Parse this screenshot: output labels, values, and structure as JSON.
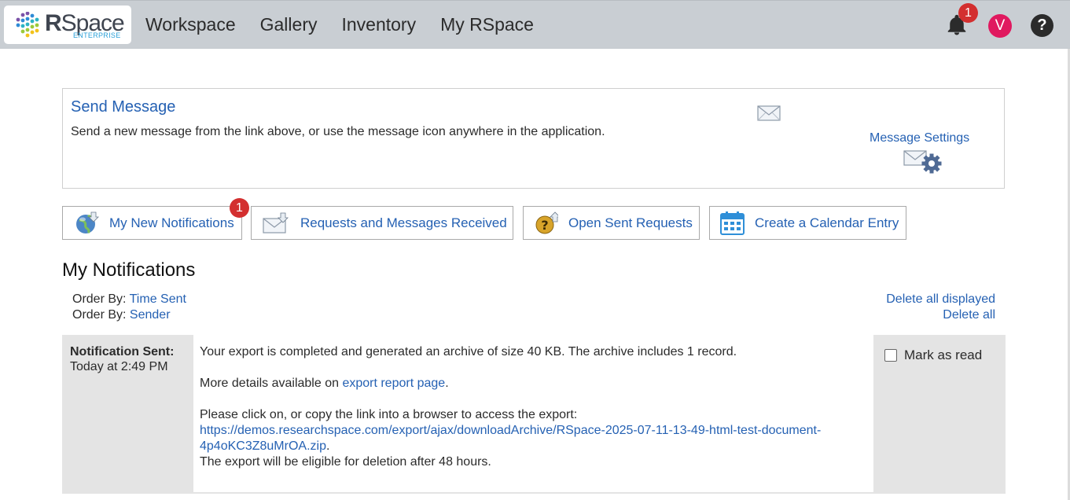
{
  "brand": {
    "name_bold": "R",
    "name_rest": "Space",
    "edition": "ENTERPRISE"
  },
  "nav": {
    "workspace": "Workspace",
    "gallery": "Gallery",
    "inventory": "Inventory",
    "my_rspace": "My RSpace"
  },
  "header": {
    "notification_count": "1",
    "avatar_initial": "V",
    "help": "?"
  },
  "send_message": {
    "title": "Send Message",
    "description": "Send a new message from the link above, or use the message icon anywhere in the application.",
    "settings_label": "Message Settings"
  },
  "actions": {
    "new_notifications": "My New Notifications",
    "new_notifications_count": "1",
    "requests_received": "Requests and Messages Received",
    "sent_requests": "Open Sent Requests",
    "calendar": "Create a Calendar Entry"
  },
  "notifications": {
    "title": "My Notifications",
    "order_prefix": "Order By:",
    "order_time": "Time Sent",
    "order_sender": "Sender",
    "delete_displayed": "Delete all displayed",
    "delete_all": "Delete all",
    "items": [
      {
        "sent_label": "Notification Sent:",
        "sent_time": "Today at 2:49 PM",
        "line1": "Your export is completed and generated an archive of size 40 KB. The archive includes 1 record.",
        "details_prefix": "More details available on ",
        "details_link": "export report page",
        "details_suffix": ".",
        "copy_text": "Please click on, or copy the link into a browser to access the export:",
        "export_url": "https://demos.researchspace.com/export/ajax/downloadArchive/RSpace-2025-07-11-13-49-html-test-document-4p4oKC3Z8uMrOA.zip",
        "url_suffix": ".",
        "deletion_note": "The export will be eligible for deletion after 48 hours.",
        "mark_read": "Mark as read"
      }
    ]
  },
  "colors": {
    "topbar": "#c9ced3",
    "link": "#2561b3",
    "badge": "#d32f2f",
    "avatar": "#e0195f"
  }
}
